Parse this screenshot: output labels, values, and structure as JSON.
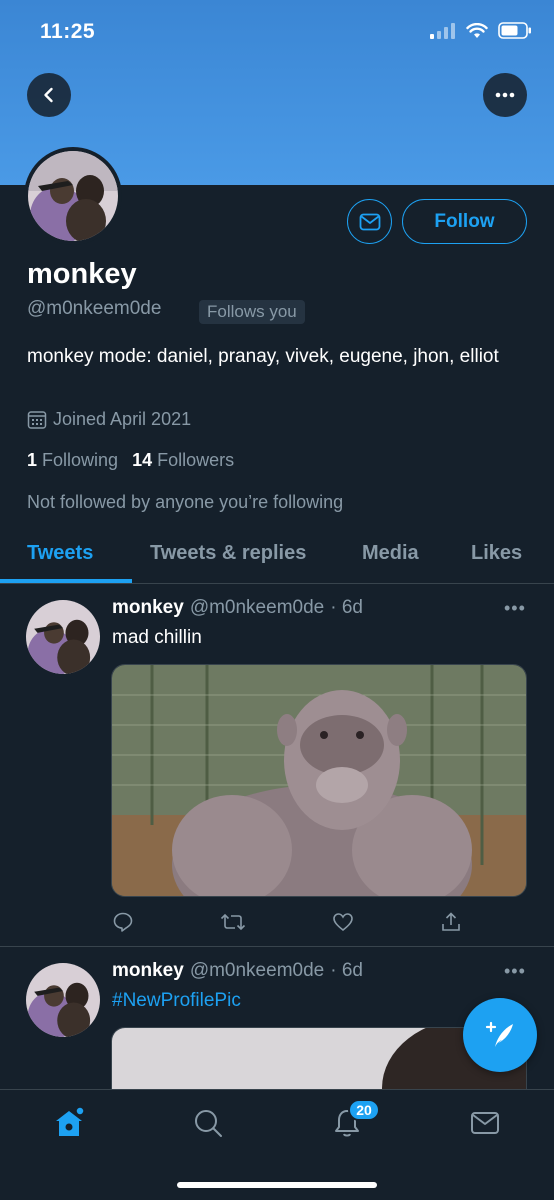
{
  "status_bar": {
    "time": "11:25"
  },
  "profile": {
    "name": "monkey",
    "handle": "@m0nkeem0de",
    "follows_you": "Follows you",
    "follow_label": "Follow",
    "bio": "monkey mode: daniel, pranay, vivek, eugene, jhon, elliot",
    "joined": "Joined April 2021",
    "following_count": "1",
    "following_label": "Following",
    "followers_count": "14",
    "followers_label": "Followers",
    "not_followed": "Not followed by anyone you’re following"
  },
  "tabs": [
    {
      "label": "Tweets",
      "active": true
    },
    {
      "label": "Tweets & replies"
    },
    {
      "label": "Media"
    },
    {
      "label": "Likes"
    }
  ],
  "tweets": [
    {
      "name": "monkey",
      "handle": "@m0nkeem0de",
      "time": "· 6d",
      "text": "mad chillin",
      "more": "•••"
    },
    {
      "name": "monkey",
      "handle": "@m0nkeem0de",
      "time": "· 6d",
      "text": "#NewProfilePic",
      "more": "•••"
    }
  ],
  "bottom_nav": {
    "notifications_badge": "20"
  },
  "icons": {
    "back": "back-arrow-icon",
    "more": "more-icon",
    "mail": "mail-icon",
    "calendar": "calendar-icon",
    "reply": "reply-icon",
    "retweet": "retweet-icon",
    "like": "heart-icon",
    "share": "share-icon",
    "compose": "compose-tweet-icon",
    "home": "home-icon",
    "search": "search-icon",
    "notifications": "bell-icon",
    "messages": "mail-icon"
  },
  "colors": {
    "accent": "#1da1f2",
    "background": "#15202b",
    "muted": "#8899a6",
    "banner": "#4a9ae6"
  }
}
